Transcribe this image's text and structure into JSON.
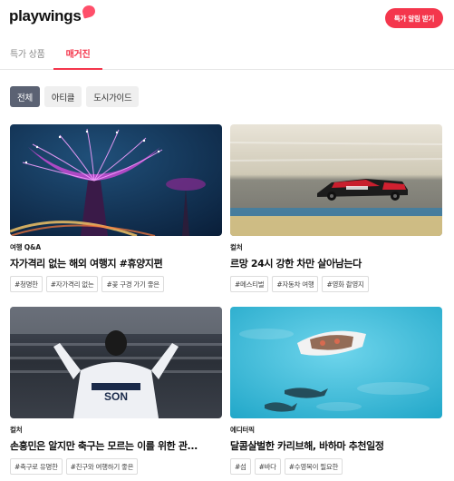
{
  "header": {
    "logo_text": "playwings",
    "cta_label": "특가 알림 받기"
  },
  "tabs": [
    {
      "label": "특가 상품",
      "active": false
    },
    {
      "label": "매거진",
      "active": true
    }
  ],
  "filters": [
    {
      "label": "전체",
      "active": true
    },
    {
      "label": "아티클",
      "active": false
    },
    {
      "label": "도시가이드",
      "active": false
    }
  ],
  "articles": [
    {
      "category": "여행 Q&A",
      "title": "자가격리 없는 해외 여행지 #휴양지편",
      "tags": [
        "#청명한",
        "#자가격리 없는",
        "#꽃 구경 가기 좋은"
      ],
      "image": "supertree-grove-night"
    },
    {
      "category": "컬처",
      "title": "르망 24시 강한 차만 살아남는다",
      "tags": [
        "#메스티벌",
        "#자동차 여행",
        "#영화 촬영지"
      ],
      "image": "le-mans-race-car"
    },
    {
      "category": "컬처",
      "title": "손흥민은 알지만 축구는 모르는 이를 위한 관...",
      "tags": [
        "#축구로 유명한",
        "#친구와 여행하기 좋은"
      ],
      "image": "soccer-fan-stadium"
    },
    {
      "category": "에디터픽",
      "title": "달콤살벌한 카리브해, 바하마 추천일정",
      "tags": [
        "#섬",
        "#바다",
        "#수영복이 필요한"
      ],
      "image": "boat-sharks-bahamas"
    }
  ],
  "colors": {
    "accent": "#f4364c",
    "chip_active": "#5b6273"
  }
}
